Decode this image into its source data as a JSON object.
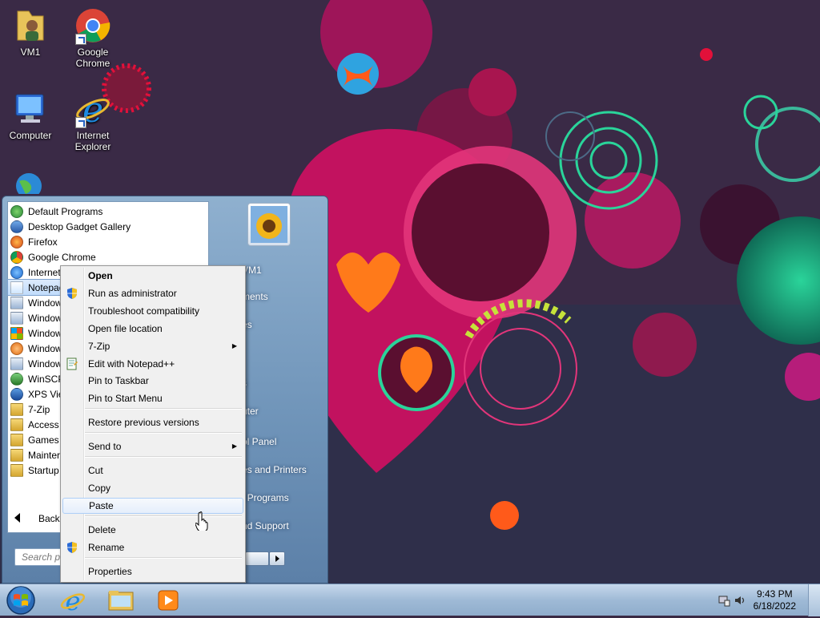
{
  "desktop": {
    "icons": [
      {
        "label": "VM1",
        "icon": "user-folder-icon"
      },
      {
        "label": "Google Chrome",
        "icon": "chrome-icon"
      },
      {
        "label": "Computer",
        "icon": "computer-icon"
      },
      {
        "label": "Internet Explorer",
        "icon": "internet-explorer-icon"
      }
    ]
  },
  "start_menu": {
    "programs": [
      {
        "label": "Default Programs",
        "icon": "default-programs-icon"
      },
      {
        "label": "Desktop Gadget Gallery",
        "icon": "gadget-icon"
      },
      {
        "label": "Firefox",
        "icon": "firefox-icon"
      },
      {
        "label": "Google Chrome",
        "icon": "chrome-icon"
      },
      {
        "label": "Internet",
        "icon": "internet-explorer-icon"
      },
      {
        "label": "Notepad",
        "icon": "notepad-icon"
      },
      {
        "label": "Window",
        "icon": "window-icon"
      },
      {
        "label": "Window",
        "icon": "window-icon"
      },
      {
        "label": "Window",
        "icon": "windows-update-icon"
      },
      {
        "label": "Window",
        "icon": "media-player-icon"
      },
      {
        "label": "Window",
        "icon": "window-icon"
      },
      {
        "label": "WinSCP",
        "icon": "winscp-icon"
      },
      {
        "label": "XPS View",
        "icon": "xps-viewer-icon"
      },
      {
        "label": "7-Zip",
        "icon": "folder-icon"
      },
      {
        "label": "Access",
        "icon": "folder-icon"
      },
      {
        "label": "Games",
        "icon": "folder-icon"
      },
      {
        "label": "Mainter",
        "icon": "folder-icon"
      },
      {
        "label": "Startup",
        "icon": "folder-icon"
      }
    ],
    "back_label": "Back",
    "search_placeholder": "Search p",
    "right_links": [
      {
        "label": "VM1"
      },
      {
        "label": "ments"
      },
      {
        "label": "es"
      },
      {
        "label": "s"
      },
      {
        "label": "uter"
      },
      {
        "label": "ol Panel"
      },
      {
        "label": "es and Printers"
      },
      {
        "label": "t Programs"
      },
      {
        "label": "nd Support"
      }
    ]
  },
  "context_menu": {
    "items": [
      {
        "label": "Open",
        "bold": true
      },
      {
        "label": "Run as administrator",
        "icon": "uac-shield-icon"
      },
      {
        "label": "Troubleshoot compatibility"
      },
      {
        "label": "Open file location"
      },
      {
        "label": "7-Zip",
        "submenu": true
      },
      {
        "label": "Edit with Notepad++",
        "icon": "notepad-plus-plus-icon"
      },
      {
        "label": "Pin to Taskbar"
      },
      {
        "label": "Pin to Start Menu"
      },
      {
        "label": "Restore previous versions"
      },
      {
        "label": "Send to",
        "submenu": true
      },
      {
        "label": "Cut"
      },
      {
        "label": "Copy"
      },
      {
        "label": "Paste",
        "hover": true
      },
      {
        "label": "Delete"
      },
      {
        "label": "Rename",
        "icon": "uac-shield-icon"
      },
      {
        "label": "Properties"
      }
    ]
  },
  "taskbar": {
    "pinned": [
      {
        "icon": "internet-explorer-icon"
      },
      {
        "icon": "explorer-folder-icon"
      },
      {
        "icon": "media-player-icon"
      }
    ],
    "clock": {
      "time": "9:43 PM",
      "date": "6/18/2022"
    }
  },
  "colors": {
    "accent": "#2b6bd6",
    "wallpaper_base": "#3b2a46",
    "taskbar": "#a9c2dc"
  }
}
